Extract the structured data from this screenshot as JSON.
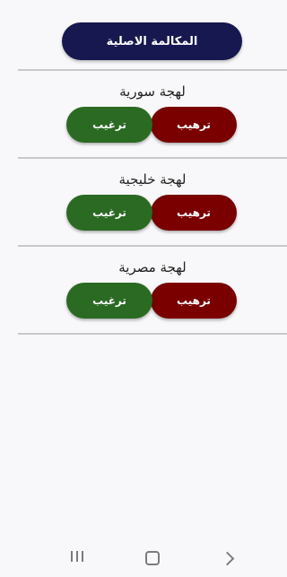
{
  "header": {
    "button_label": "المكالمة الاصلية"
  },
  "sections": [
    {
      "title": "لهجة سورية",
      "left_label": "ترغيب",
      "right_label": "ترهيب"
    },
    {
      "title": "لهجة خليجية",
      "left_label": "ترغيب",
      "right_label": "ترهيب"
    },
    {
      "title": "لهجة مصرية",
      "left_label": "ترغيب",
      "right_label": "ترهيب"
    }
  ],
  "colors": {
    "primary": "#17184f",
    "red_button": "#7a0000",
    "green_button": "#2a6a22"
  },
  "navbar": {
    "icons": [
      "recent-apps-icon",
      "home-icon",
      "back-icon"
    ]
  }
}
